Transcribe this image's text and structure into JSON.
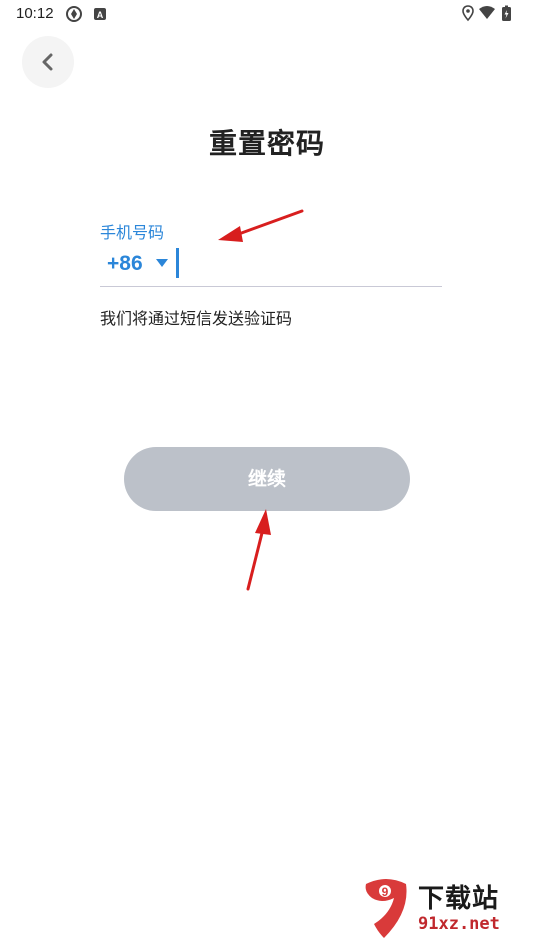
{
  "status_bar": {
    "time": "10:12",
    "icons_left": [
      "sync-icon",
      "a-icon"
    ],
    "icons_right": [
      "location-icon",
      "wifi-icon",
      "battery-icon"
    ]
  },
  "header": {
    "back_icon": "chevron-left-icon",
    "title": "重置密码"
  },
  "form": {
    "label": "手机号码",
    "country_code": "+86",
    "dropdown_icon": "triangle-down-icon",
    "phone_value": "",
    "hint": "我们将通过短信发送验证码"
  },
  "actions": {
    "continue_label": "继续"
  },
  "watermark": {
    "logo_text": "9",
    "title": "下载站",
    "domain": "91xz.net"
  },
  "colors": {
    "accent": "#2b86d9",
    "button_disabled": "#bcc1c9",
    "annotation_arrow": "#d81e1e",
    "watermark_red": "#c0282d"
  }
}
